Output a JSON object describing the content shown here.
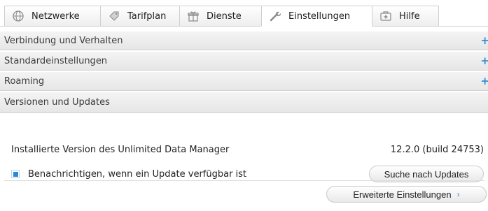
{
  "tabs": [
    {
      "label": "Netzwerke",
      "icon": "globe-icon"
    },
    {
      "label": "Tarifplan",
      "icon": "tag-icon"
    },
    {
      "label": "Dienste",
      "icon": "gift-icon"
    },
    {
      "label": "Einstellungen",
      "icon": "wrench-icon"
    },
    {
      "label": "Hilfe",
      "icon": "firstaid-icon"
    }
  ],
  "sections": [
    {
      "label": "Verbindung und Verhalten",
      "expand": "+"
    },
    {
      "label": "Standardeinstellungen",
      "expand": "+"
    },
    {
      "label": "Roaming",
      "expand": "+"
    },
    {
      "label": "Versionen und Updates"
    }
  ],
  "content": {
    "installed_label": "Installierte Version des Unlimited Data Manager",
    "installed_value": "12.2.0 (build 24753)",
    "notify_label": "Benachrichtigen, wenn ein Update verfügbar ist",
    "notify_checked": true,
    "check_updates_button": "Suche nach Updates",
    "advanced_button": "Erweiterte Einstellungen",
    "advanced_chevron": "›"
  },
  "colors": {
    "accent": "#2f8fd0"
  }
}
